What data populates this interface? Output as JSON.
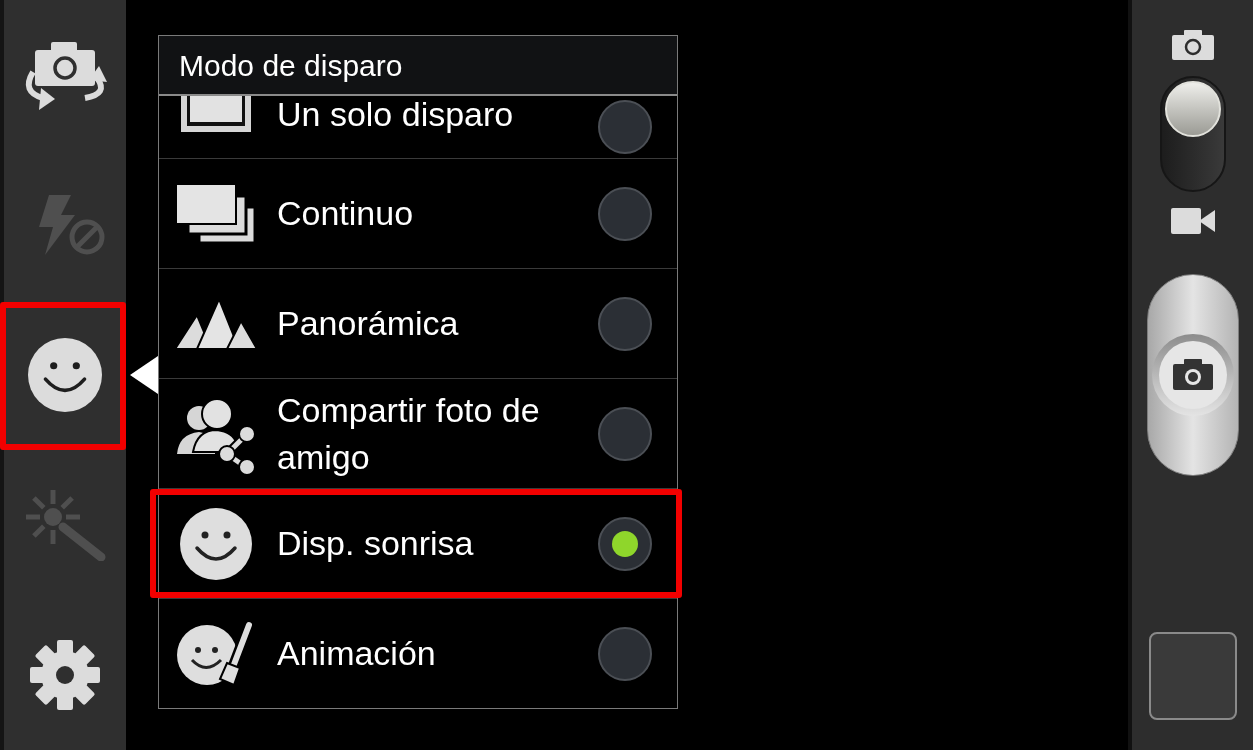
{
  "sidebar": {
    "items": [
      {
        "kind": "camera_switch",
        "disabled": false,
        "selected": false,
        "highlighted": false
      },
      {
        "kind": "flash_off",
        "disabled": true,
        "selected": false,
        "highlighted": false
      },
      {
        "kind": "shooting_mode",
        "disabled": false,
        "selected": true,
        "highlighted": true
      },
      {
        "kind": "effects",
        "disabled": true,
        "selected": false,
        "highlighted": false
      },
      {
        "kind": "settings",
        "disabled": false,
        "selected": false,
        "highlighted": false
      }
    ]
  },
  "mode_popup": {
    "title": "Modo de disparo",
    "items": [
      {
        "kind": "single",
        "label": "Un solo disparo",
        "selected": false,
        "highlighted": false
      },
      {
        "kind": "burst",
        "label": "Continuo",
        "selected": false,
        "highlighted": false
      },
      {
        "kind": "panorama",
        "label": "Panorámica",
        "selected": false,
        "highlighted": false
      },
      {
        "kind": "share",
        "label": "Compartir foto de amigo",
        "selected": false,
        "highlighted": false
      },
      {
        "kind": "smile",
        "label": "Disp. sonrisa",
        "selected": true,
        "highlighted": true
      },
      {
        "kind": "animation",
        "label": "Animación",
        "selected": false,
        "highlighted": false
      }
    ]
  },
  "mode_switch": {
    "video": false
  }
}
